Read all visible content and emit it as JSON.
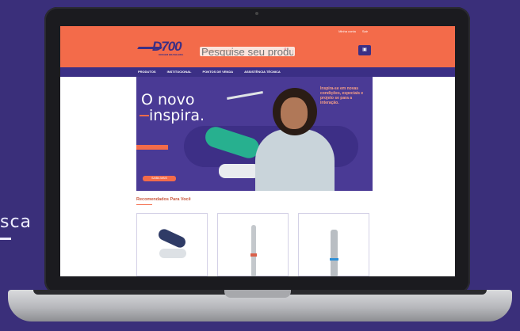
{
  "side_text": "sca",
  "site": {
    "logo": "D700",
    "logo_sub": "ORIGEM BRASILEIRA",
    "util_links": [
      "Minha conta",
      "Sair"
    ],
    "search_placeholder": "Pesquise seu produto",
    "nav": [
      "PRODUTOS",
      "INSTITUCIONAL",
      "PONTOS DE VENDA",
      "ASSISTÊNCIA TÉCNICA"
    ],
    "banner": {
      "line1": "O novo",
      "line2": "inspira.",
      "tagline": "Inspira-se em novas condições, especiais e projeto se para a interação.",
      "cta": "SAIBA MAIS"
    },
    "recommended_title": "Recomendados Para Você"
  },
  "colors": {
    "brand_orange": "#f36b4a",
    "brand_purple": "#3b2f85",
    "background": "#3a2f7a"
  }
}
